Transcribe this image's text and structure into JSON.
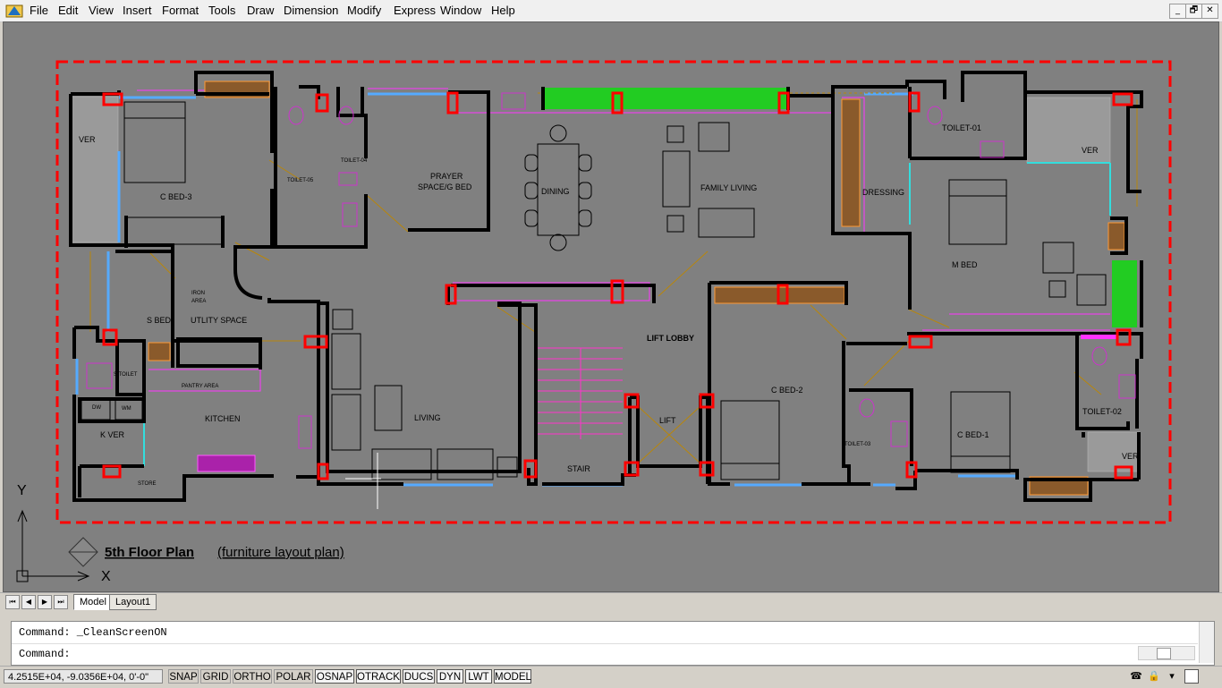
{
  "menu": [
    "File",
    "Edit",
    "View",
    "Insert",
    "Format",
    "Tools",
    "Draw",
    "Dimension",
    "Modify",
    "Express",
    "Window",
    "Help"
  ],
  "window_buttons": {
    "minimize": "_",
    "restore": "🗗",
    "close": "✕"
  },
  "drawing": {
    "title_main": "5th Floor Plan",
    "title_sub": "(furniture layout plan)",
    "ucs": {
      "y": "Y",
      "x": "X"
    },
    "rooms": {
      "ver_left": "VER",
      "c_bed_3": "C BED-3",
      "toilet_04": "TOILET-04",
      "toilet_05": "TOILET-05",
      "prayer_1": "PRAYER",
      "prayer_2": "SPACE/G BED",
      "dining": "DINING",
      "family_living": "FAMILY LIVING",
      "dressing": "DRESSING",
      "toilet_01": "TOILET-01",
      "ver_right": "VER",
      "m_bed": "M BED",
      "iron_1": "IRON",
      "iron_2": "AREA",
      "s_bed": "S BED",
      "utility": "UTLITY SPACE",
      "s_toilet": "S TOILET",
      "pantry": "PANTRY AREA",
      "dw": "DW",
      "wm": "WM",
      "kitchen": "KITCHEN",
      "k_ver": "K VER",
      "store": "STORE",
      "living": "LIVING",
      "lift_lobby": "LIFT LOBBY",
      "lift": "LIFT",
      "stair": "STAIR",
      "c_bed_2": "C BED-2",
      "toilet_03": "TOILET-03",
      "c_bed_1": "C BED-1",
      "toilet_02": "TOILET-02",
      "ver_bottom_right": "VER"
    }
  },
  "tabs": [
    "Model",
    "Layout1"
  ],
  "command": {
    "history": "Command:  _CleanScreenON",
    "prompt": "Command:"
  },
  "status": {
    "coords": "4.2515E+04, -9.0356E+04, 0'-0\"",
    "buttons": [
      "SNAP",
      "GRID",
      "ORTHO",
      "POLAR",
      "OSNAP",
      "OTRACK",
      "DUCS",
      "DYN",
      "LWT",
      "MODEL"
    ]
  }
}
